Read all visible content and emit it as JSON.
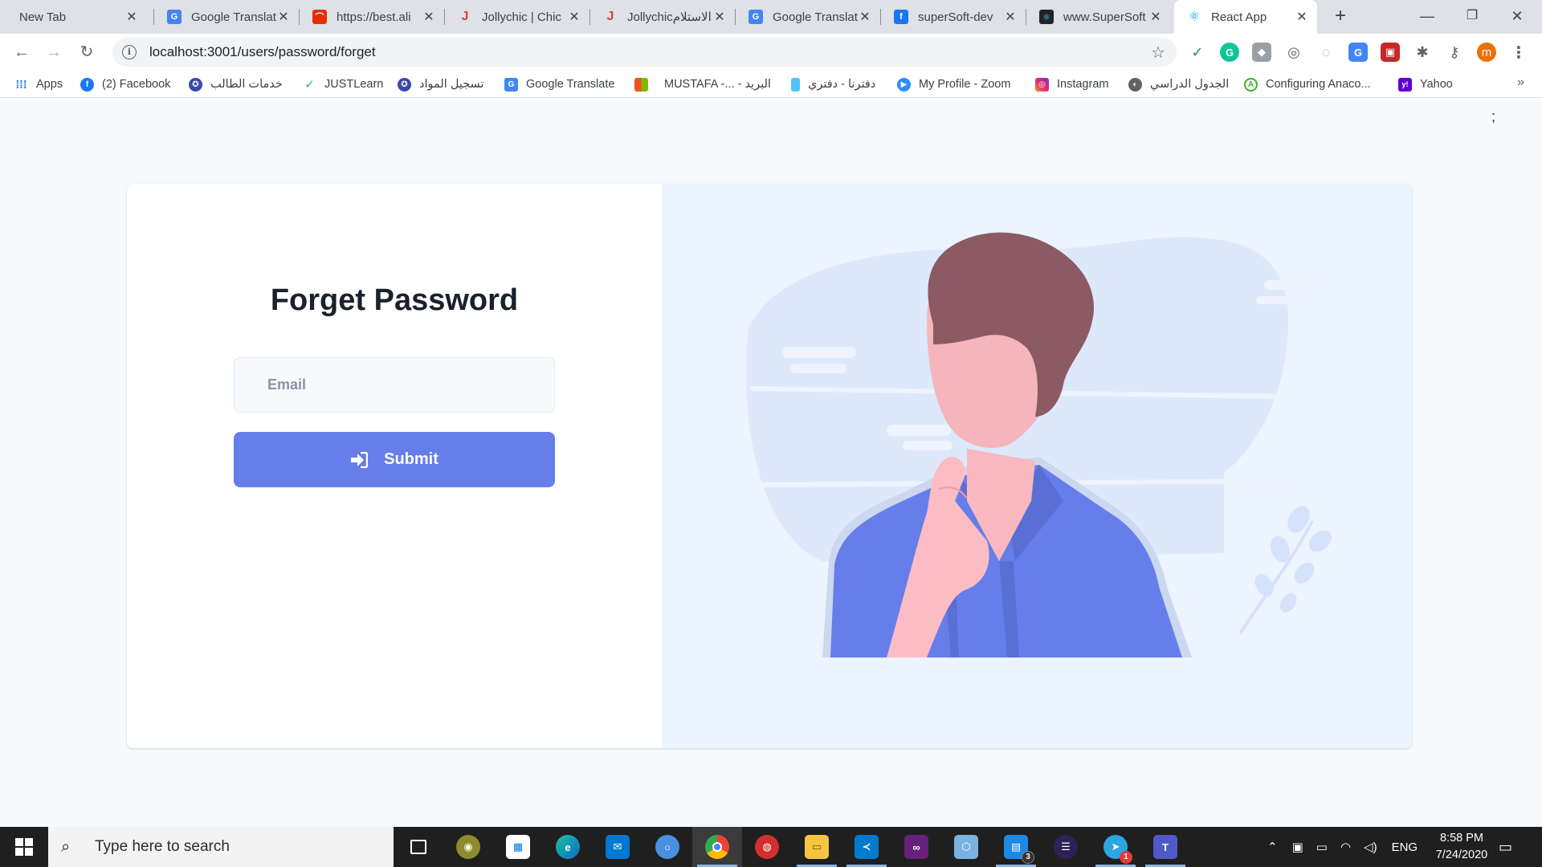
{
  "tabs": [
    {
      "title": "New Tab",
      "icon": "blank-icon"
    },
    {
      "title": "Google Translat",
      "icon": "google-translate-icon"
    },
    {
      "title": "https://best.ali",
      "icon": "aliexpress-icon"
    },
    {
      "title": "Jollychic | Chic",
      "icon": "jollychic-icon"
    },
    {
      "title": "Jollychicالاستلام",
      "icon": "jollychic-icon"
    },
    {
      "title": "Google Translat",
      "icon": "google-translate-icon"
    },
    {
      "title": "superSoft-dev",
      "icon": "facebook-icon"
    },
    {
      "title": "www.SuperSoft",
      "icon": "react-icon"
    },
    {
      "title": "React App",
      "icon": "react-icon"
    }
  ],
  "address_bar": {
    "url": "localhost:3001/users/password/forget"
  },
  "bookmarks": [
    {
      "label": "Apps",
      "icon": "apps-grid-icon"
    },
    {
      "label": "(2) Facebook",
      "icon": "facebook-icon"
    },
    {
      "label": "خدمات الطالب",
      "icon": "university-icon"
    },
    {
      "label": "JUSTLearn",
      "icon": "justlearn-icon"
    },
    {
      "label": "تسجيل المواد",
      "icon": "university-icon"
    },
    {
      "label": "Google Translate",
      "icon": "google-translate-icon"
    },
    {
      "label": "MUSTAFA -... - البريد",
      "icon": "microsoft-icon"
    },
    {
      "label": "دفترنا - دفتري",
      "icon": "bookmark-icon"
    },
    {
      "label": "My Profile - Zoom",
      "icon": "zoom-icon"
    },
    {
      "label": "Instagram",
      "icon": "instagram-icon"
    },
    {
      "label": "الجدول الدراسي",
      "icon": "globe-icon"
    },
    {
      "label": "Configuring Anaco...",
      "icon": "anaconda-icon"
    },
    {
      "label": "Yahoo",
      "icon": "yahoo-icon"
    }
  ],
  "profile_initial": "m",
  "page": {
    "corner_mark": ";",
    "title": "Forget Password",
    "email_placeholder": "Email",
    "submit_label": "Submit"
  },
  "taskbar": {
    "search_placeholder": "Type here to search",
    "language": "ENG",
    "time": "8:58 PM",
    "date": "7/24/2020",
    "badge_files": "3",
    "badge_telegram": "1"
  },
  "colors": {
    "accent": "#667eea",
    "illustration_bg": "#ebf4ff",
    "page_bg": "#f7fafc",
    "title": "#1a202c"
  }
}
